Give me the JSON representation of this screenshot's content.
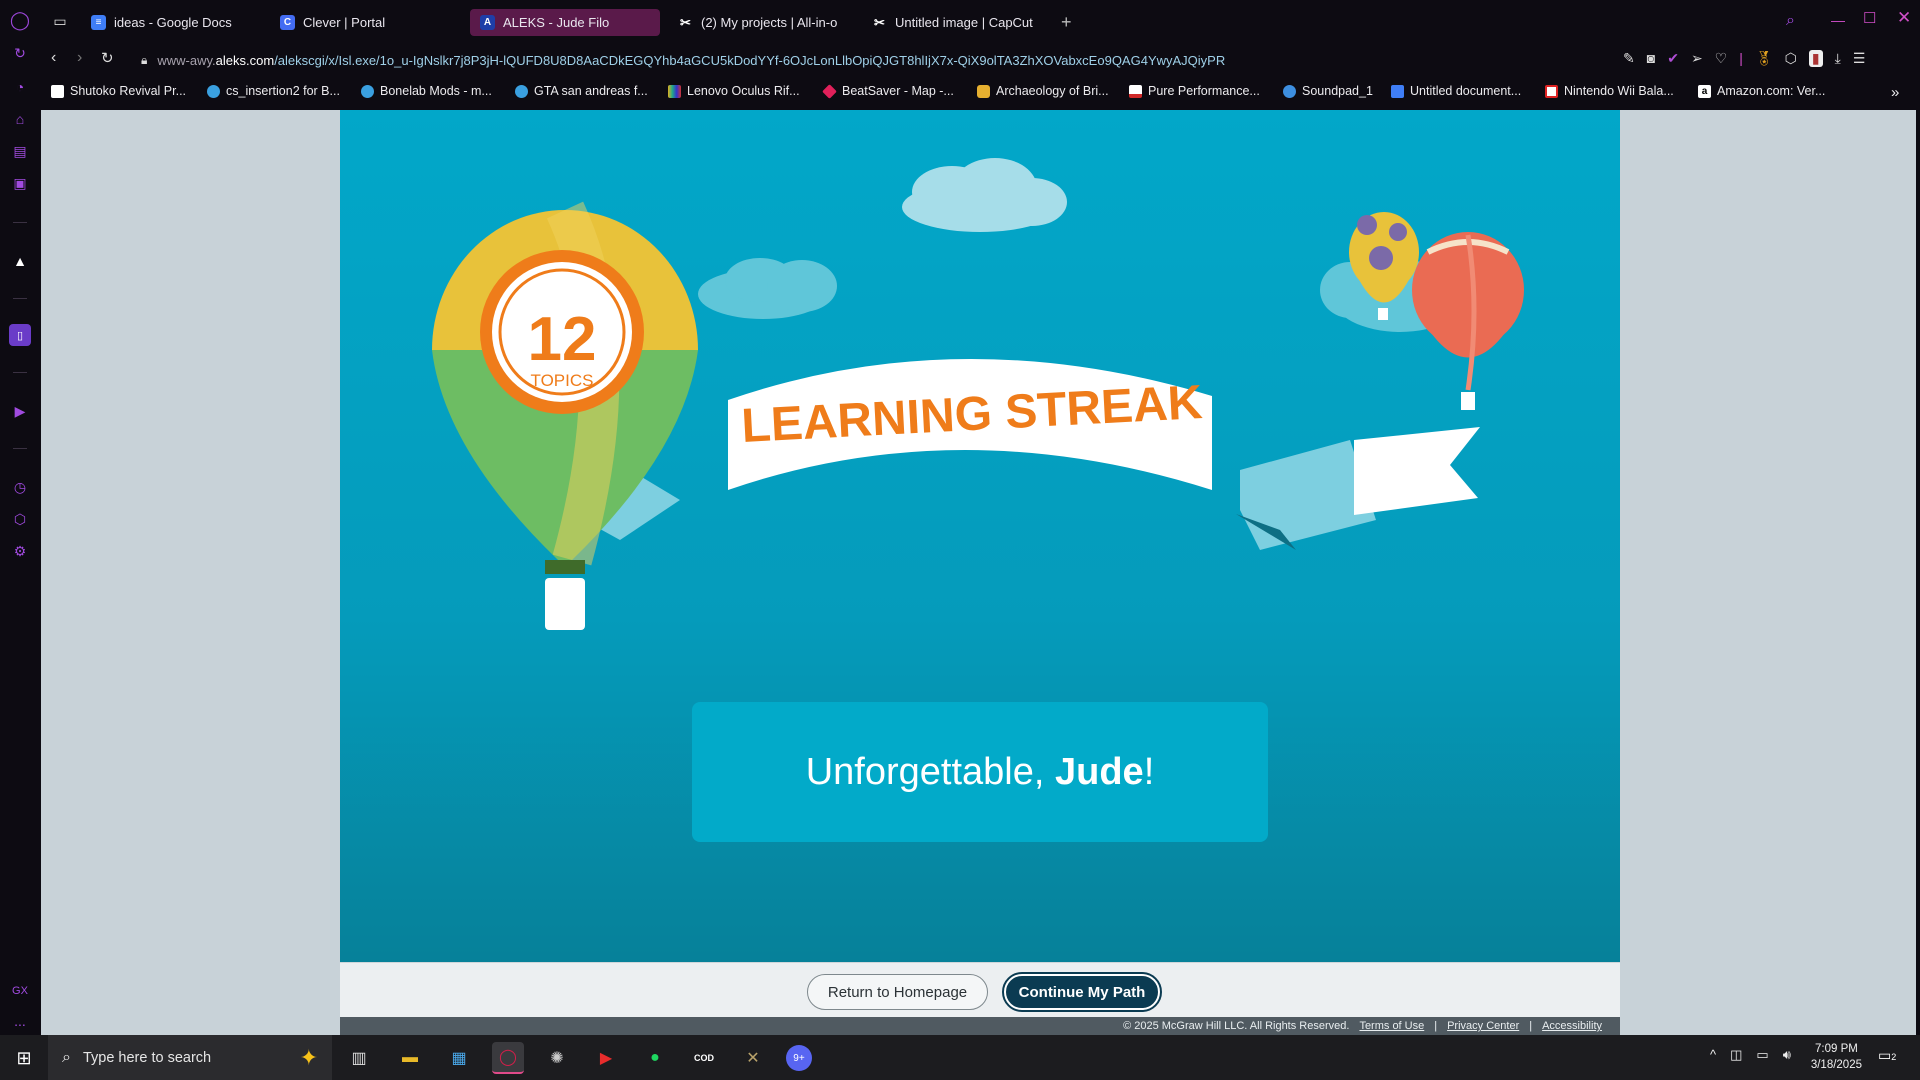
{
  "browser": {
    "tabs": [
      {
        "label": "ideas - Google Docs",
        "icon": "google-docs-icon",
        "color": "#3f7ef6"
      },
      {
        "label": "Clever | Portal",
        "icon": "clever-icon",
        "color": "#436cf2"
      },
      {
        "label": "ALEKS - Jude Filo",
        "icon": "aleks-icon",
        "color": "#1e3ea8",
        "active": true
      },
      {
        "label": "(2) My projects | All-in-o",
        "icon": "capcut-icon",
        "color": "#ffffff"
      },
      {
        "label": "Untitled image | CapCut",
        "icon": "capcut-icon",
        "color": "#ffffff"
      }
    ],
    "new_tab": "+",
    "url_domain_prefix": "www-awy.",
    "url_domain_main": "aleks.com",
    "url_path": "/alekscgi/x/Isl.exe/1o_u-IgNslkr7j8P3jH-lQUFD8U8D8AaCDkEGQYhb4aGCU5kDodYYf-6OJcLonLlbOpiQJGT8hlIjX7x-QiX9olTA3ZhXOVabxcEo9QAG4YwyAJQiyPR",
    "bookmarks": [
      {
        "label": "Shutoko Revival Pr...",
        "icon": "page-icon",
        "color": "#ffffff"
      },
      {
        "label": "cs_insertion2 for B...",
        "icon": "gear-badge-icon",
        "color": "#3aa0e0"
      },
      {
        "label": "Bonelab Mods - m...",
        "icon": "gear-badge-icon",
        "color": "#3aa0e0"
      },
      {
        "label": "GTA san andreas f...",
        "icon": "gear-badge-icon",
        "color": "#3aa0e0"
      },
      {
        "label": "Lenovo Oculus Rif...",
        "icon": "stripes-icon",
        "color": "#e0b020"
      },
      {
        "label": "BeatSaver - Map -...",
        "icon": "diamond-icon",
        "color": "#e0205a"
      },
      {
        "label": "Archaeology of Bri...",
        "icon": "hexagon-icon",
        "color": "#e6b030"
      },
      {
        "label": "Pure Performance...",
        "icon": "flag-icon",
        "color": "#d02828"
      },
      {
        "label": "Soundpad_1",
        "icon": "cloud-icon",
        "color": "#3d8fe0"
      },
      {
        "label": "Untitled document...",
        "icon": "google-docs-icon",
        "color": "#3f7ef6"
      },
      {
        "label": "Nintendo Wii Bala...",
        "icon": "sg-icon",
        "color": "#d22"
      },
      {
        "label": "Amazon.com: Ver...",
        "icon": "amazon-icon",
        "color": "#ffffff"
      }
    ]
  },
  "page": {
    "banner_text": "LEARNING STREAK",
    "badge_number": "12",
    "badge_unit": "TOPICS",
    "message_prefix": "Unforgettable, ",
    "message_name": "Jude",
    "message_suffix": "!",
    "return_button": "Return to Homepage",
    "continue_button": "Continue My Path",
    "copyright": "© 2025 McGraw Hill LLC. All Rights Reserved.",
    "links": [
      "Terms of Use",
      "Privacy Center",
      "Accessibility"
    ],
    "sep": "|"
  },
  "taskbar": {
    "search_placeholder": "Type here to search",
    "time": "7:09 PM",
    "date": "3/18/2025",
    "notif_count": "2",
    "discord_badge": "9+"
  },
  "sidebar": {
    "gx_label": "GX",
    "more_label": "..."
  }
}
